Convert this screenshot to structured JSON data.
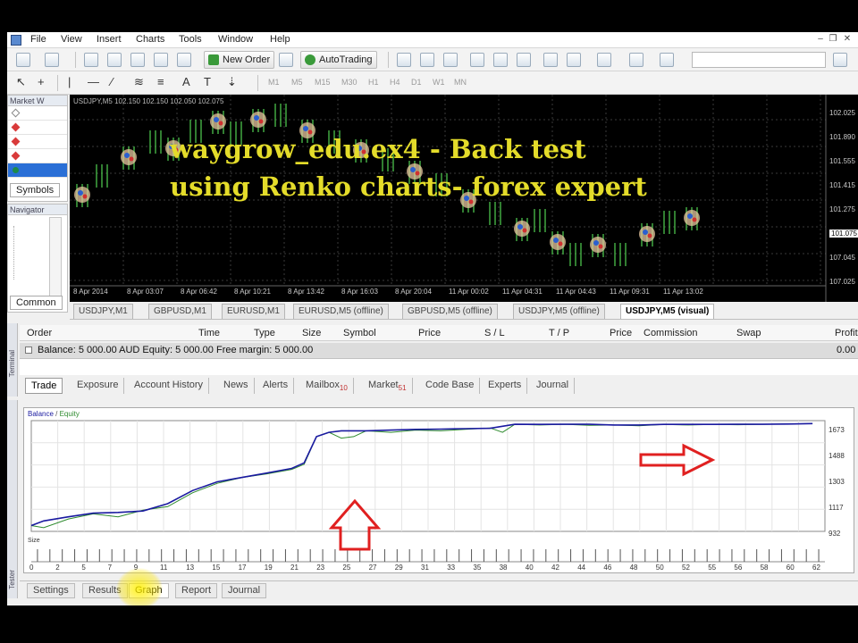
{
  "menu": {
    "items": [
      "File",
      "View",
      "Insert",
      "Charts",
      "Tools",
      "Window",
      "Help"
    ]
  },
  "toolbar": {
    "new_order_label": "New Order",
    "autotrading_label": "AutoTrading",
    "timeframes": [
      "M1",
      "M5",
      "M15",
      "M30",
      "H1",
      "H4",
      "D1",
      "W1",
      "MN"
    ]
  },
  "market_watch": {
    "title": "Market W",
    "symbol_colors": [
      "#ffffff",
      "#d93a3a",
      "#d93a3a",
      "#d93a3a",
      "#1e8a4a"
    ],
    "tab_label": "Symbols"
  },
  "navigator": {
    "title": "Navigator",
    "tab_label": "Common"
  },
  "chart": {
    "header": "USDJPY,M5 102.150 102.150 102.050 102.075",
    "overlay_line1": "waygrow_edu.ex4 - Back test",
    "overlay_line2": "using Renko charts- forex expert",
    "price_labels": [
      "102.025",
      "101.890",
      "101.555",
      "101.415",
      "101.275",
      "101.075",
      "107.045",
      "107.025"
    ],
    "current_price": "101.075",
    "time_labels": [
      "8 Apr 2014",
      "8 Apr 03:07",
      "8 Apr 06:42",
      "8 Apr 10:21",
      "8 Apr 13:42",
      "8 Apr 16:03",
      "8 Apr 20:04",
      "11 Apr 00:02",
      "11 Apr 04:31",
      "11 Apr 04:43",
      "11 Apr 09:31",
      "11 Apr 13:02"
    ],
    "colors": {
      "up_line": "#4cc24c",
      "overlay_text": "#e4dc2a"
    }
  },
  "chart_tabs": [
    "USDJPY,M1",
    "GBPUSD,M1",
    "EURUSD,M1",
    "EURUSD,M5 (offline)",
    "GBPUSD,M5 (offline)",
    "USDJPY,M5 (offline)",
    "USDJPY,M5 (visual)"
  ],
  "terminal": {
    "columns": [
      "Order",
      "Time",
      "Type",
      "Size",
      "Symbol",
      "Price",
      "S / L",
      "T / P",
      "Price",
      "Commission",
      "Swap",
      "Profit"
    ],
    "balance_text": "Balance: 5 000.00 AUD  Equity: 5 000.00  Free margin: 5 000.00",
    "balance_profit": "0.00",
    "tabs": [
      {
        "label": "Trade",
        "badge": ""
      },
      {
        "label": "Exposure",
        "badge": ""
      },
      {
        "label": "Account History",
        "badge": ""
      },
      {
        "label": "News",
        "badge": ""
      },
      {
        "label": "Alerts",
        "badge": ""
      },
      {
        "label": "Mailbox",
        "badge": "10"
      },
      {
        "label": "Market",
        "badge": "51"
      },
      {
        "label": "Code Base",
        "badge": ""
      },
      {
        "label": "Experts",
        "badge": ""
      },
      {
        "label": "Journal",
        "badge": ""
      }
    ],
    "side_label": "Terminal"
  },
  "graph": {
    "legend_balance": "Balance",
    "legend_equity": "Equity",
    "size_label": "Size",
    "side_label": "Tester"
  },
  "chart_data": {
    "type": "line",
    "title": "",
    "xlabel": "",
    "ylabel": "",
    "series": [
      {
        "name": "Balance",
        "color": "#1a1aa0",
        "x": [
          0,
          1,
          3,
          5,
          7,
          9,
          11,
          13,
          15,
          17,
          19,
          21,
          22,
          23,
          24,
          25,
          27,
          29,
          31,
          33,
          35,
          37,
          39,
          41,
          43,
          45,
          47,
          49,
          51,
          53,
          55,
          57,
          59,
          61,
          63
        ],
        "y": [
          5000,
          5032,
          5060,
          5085,
          5090,
          5100,
          5150,
          5240,
          5300,
          5330,
          5360,
          5392,
          5430,
          5610,
          5640,
          5650,
          5650,
          5655,
          5660,
          5662,
          5665,
          5667,
          5695,
          5694,
          5695,
          5695,
          5690,
          5690,
          5694,
          5694,
          5694,
          5695,
          5695,
          5697,
          5700
        ]
      },
      {
        "name": "Equity",
        "color": "#2e8b2e",
        "x": [
          0,
          1,
          3,
          5,
          7,
          9,
          11,
          13,
          15,
          17,
          19,
          21,
          22,
          23,
          24,
          25,
          26,
          27,
          29,
          31,
          33,
          35,
          37,
          38,
          39,
          41,
          43,
          45,
          47,
          49,
          51,
          53,
          55,
          57,
          59,
          61,
          63
        ],
        "y": [
          5000,
          4985,
          5045,
          5080,
          5060,
          5105,
          5130,
          5225,
          5290,
          5330,
          5355,
          5385,
          5420,
          5610,
          5640,
          5600,
          5610,
          5650,
          5640,
          5655,
          5650,
          5660,
          5670,
          5640,
          5695,
          5690,
          5695,
          5688,
          5690,
          5685,
          5694,
          5690,
          5694,
          5692,
          5695,
          5697,
          5700
        ]
      }
    ],
    "y_tick_labels": [
      "1673",
      "1488",
      "1303",
      "1117",
      "932"
    ],
    "x_tick_labels": [
      "0",
      "2",
      "5",
      "7",
      "9",
      "11",
      "13",
      "15",
      "17",
      "19",
      "21",
      "23",
      "25",
      "27",
      "29",
      "31",
      "33",
      "35",
      "38",
      "40",
      "42",
      "44",
      "46",
      "48",
      "50",
      "52",
      "55",
      "56",
      "58",
      "60",
      "62"
    ],
    "ylim": [
      4960,
      5720
    ],
    "xlim": [
      0,
      64
    ],
    "grid": true,
    "legend": "top-left"
  }
}
